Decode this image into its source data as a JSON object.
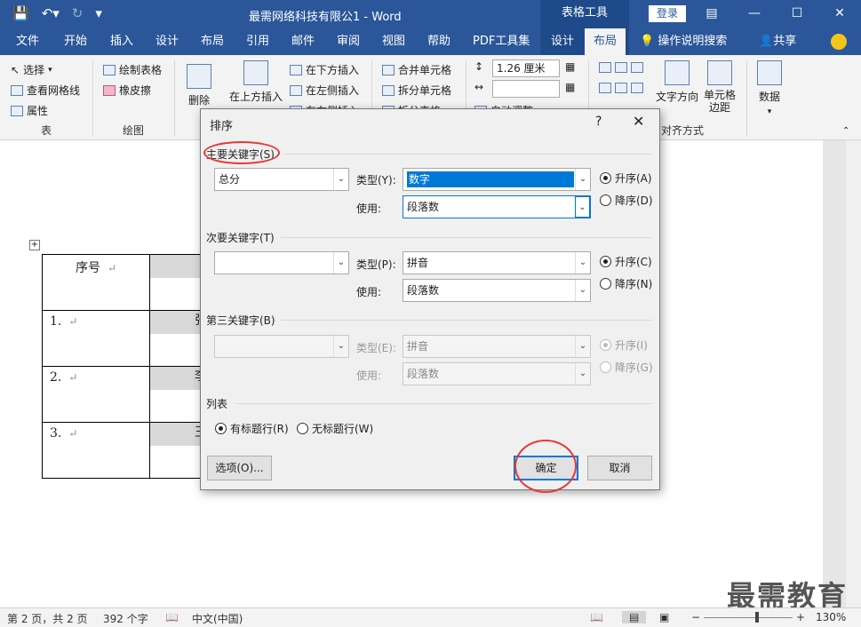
{
  "app": {
    "title": "最需网络科技有限公1  -  Word",
    "context_tools": "表格工具",
    "login": "登录",
    "window_controls": [
      "ribbon-display-icon",
      "minimize-icon",
      "maximize-icon",
      "close-icon"
    ]
  },
  "tabs": [
    {
      "label": "文件"
    },
    {
      "label": "开始"
    },
    {
      "label": "插入"
    },
    {
      "label": "设计"
    },
    {
      "label": "布局"
    },
    {
      "label": "引用"
    },
    {
      "label": "邮件"
    },
    {
      "label": "审阅"
    },
    {
      "label": "视图"
    },
    {
      "label": "帮助"
    },
    {
      "label": "PDF工具集"
    },
    {
      "label": "设计"
    },
    {
      "label": "布局",
      "active": true
    }
  ],
  "search": "操作说明搜索",
  "share": "共享",
  "ribbon": {
    "select": "选择",
    "view_grid": "查看网格线",
    "properties": "属性",
    "group_table": "表",
    "draw_table": "绘制表格",
    "eraser": "橡皮擦",
    "group_draw": "绘图",
    "delete": "删除",
    "insert_above": "在上方插入",
    "insert_below": "在下方插入",
    "insert_left": "在左侧插入",
    "insert_right": "在右侧插入",
    "merge_cells": "合并单元格",
    "split_cells": "拆分单元格",
    "split_table": "拆分表格",
    "height_value": "1.26 厘米",
    "autofit": "自动调整",
    "text_direction": "文字方向",
    "cell_margins": "单元格\n边距",
    "data": "数据",
    "group_align": "对齐方式"
  },
  "document": {
    "header_cell": "序号",
    "rows": [
      "1.",
      "2.",
      "3."
    ],
    "row_fragments": [
      "张",
      "李",
      "王"
    ],
    "watermark": "最需教育"
  },
  "statusbar": {
    "page": "第 2 页，共 2 页",
    "words": "392 个字",
    "lang": "中文(中国)",
    "zoom": "130%",
    "zoom_level": 0.6
  },
  "dialog": {
    "title": "排序",
    "help": "?",
    "primary_key_label": "主要关键字(S)",
    "primary_key_value": "总分",
    "primary_type_label": "类型(Y):",
    "primary_type_value": "数字",
    "primary_using_label": "使用:",
    "primary_using_value": "段落数",
    "asc_a": "升序(A)",
    "desc_d": "降序(D)",
    "secondary_key_label": "次要关键字(T)",
    "secondary_key_value": "",
    "secondary_type_label": "类型(P):",
    "secondary_type_value": "拼音",
    "secondary_using_label": "使用:",
    "secondary_using_value": "段落数",
    "asc_c": "升序(C)",
    "desc_n": "降序(N)",
    "third_key_label": "第三关键字(B)",
    "third_key_value": "",
    "third_type_label": "类型(E):",
    "third_type_value": "拼音",
    "third_using_label": "使用:",
    "third_using_value": "段落数",
    "asc_i": "升序(I)",
    "desc_g": "降序(G)",
    "list_label": "列表",
    "has_header": "有标题行(R)",
    "no_header": "无标题行(W)",
    "options_button": "选项(O)...",
    "ok_button": "确定",
    "cancel_button": "取消"
  }
}
